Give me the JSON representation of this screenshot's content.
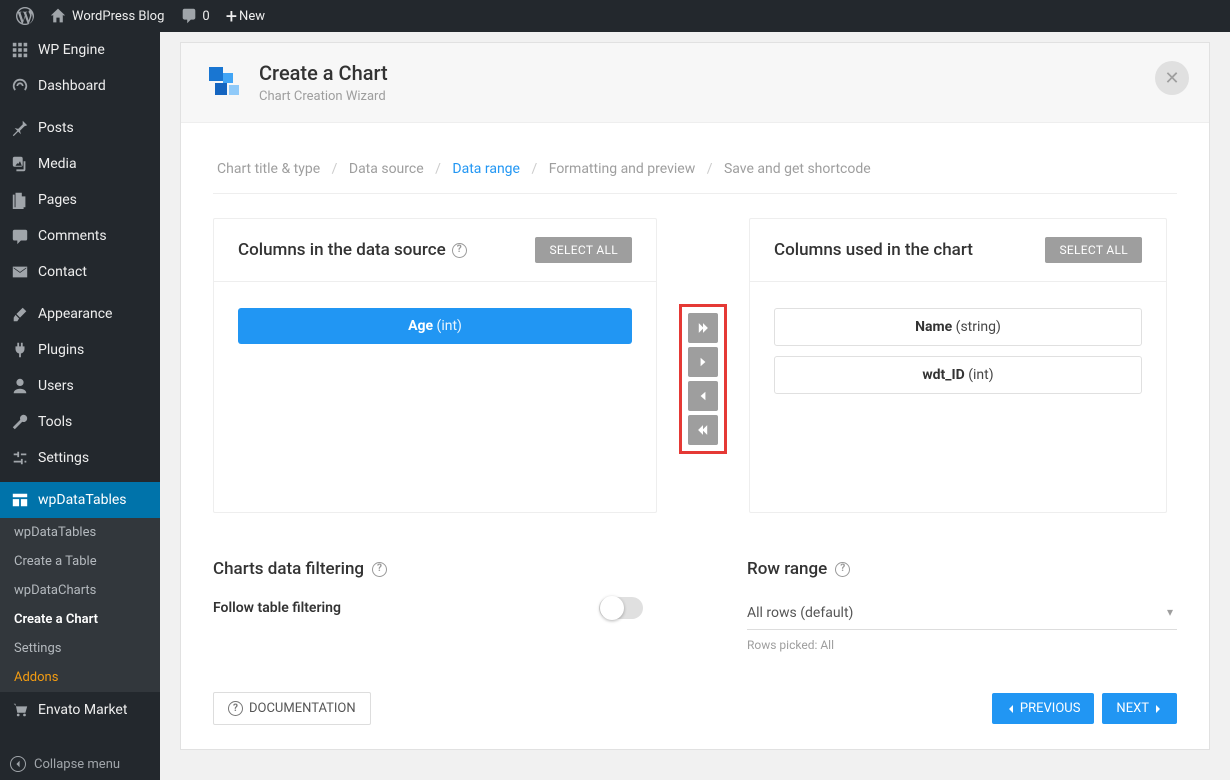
{
  "adminbar": {
    "site_name": "WordPress Blog",
    "comments_count": "0",
    "new_label": "New"
  },
  "sidebar": {
    "items": [
      {
        "label": "WP Engine",
        "icon": "wpengine"
      },
      {
        "label": "Dashboard",
        "icon": "dashboard"
      },
      {
        "label": "Posts",
        "icon": "pin"
      },
      {
        "label": "Media",
        "icon": "media"
      },
      {
        "label": "Pages",
        "icon": "pages"
      },
      {
        "label": "Comments",
        "icon": "comment"
      },
      {
        "label": "Contact",
        "icon": "mail"
      },
      {
        "label": "Appearance",
        "icon": "brush"
      },
      {
        "label": "Plugins",
        "icon": "plug"
      },
      {
        "label": "Users",
        "icon": "user"
      },
      {
        "label": "Tools",
        "icon": "wrench"
      },
      {
        "label": "Settings",
        "icon": "sliders"
      },
      {
        "label": "wpDataTables",
        "icon": "table",
        "active": true
      },
      {
        "label": "Envato Market",
        "icon": "cart"
      }
    ],
    "submenu": [
      {
        "label": "wpDataTables"
      },
      {
        "label": "Create a Table"
      },
      {
        "label": "wpDataCharts"
      },
      {
        "label": "Create a Chart",
        "current": true
      },
      {
        "label": "Settings"
      },
      {
        "label": "Addons",
        "addons": true
      }
    ],
    "collapse_label": "Collapse menu"
  },
  "header": {
    "title": "Create a Chart",
    "subtitle": "Chart Creation Wizard"
  },
  "breadcrumb": {
    "steps": [
      "Chart title & type",
      "Data source",
      "Data range",
      "Formatting and preview",
      "Save and get shortcode"
    ],
    "active_index": 2
  },
  "panels": {
    "left": {
      "title": "Columns in the data source",
      "select_all": "SELECT ALL",
      "columns": [
        {
          "name": "Age",
          "type": "(int)",
          "selected": true
        }
      ]
    },
    "right": {
      "title": "Columns used in the chart",
      "select_all": "SELECT ALL",
      "columns": [
        {
          "name": "Name",
          "type": "(string)"
        },
        {
          "name": "wdt_ID",
          "type": "(int)"
        }
      ]
    }
  },
  "filtering": {
    "title": "Charts data filtering",
    "follow_label": "Follow table filtering"
  },
  "row_range": {
    "title": "Row range",
    "value": "All rows (default)",
    "helper": "Rows picked: All"
  },
  "footer": {
    "documentation": "DOCUMENTATION",
    "previous": "PREVIOUS",
    "next": "NEXT"
  }
}
